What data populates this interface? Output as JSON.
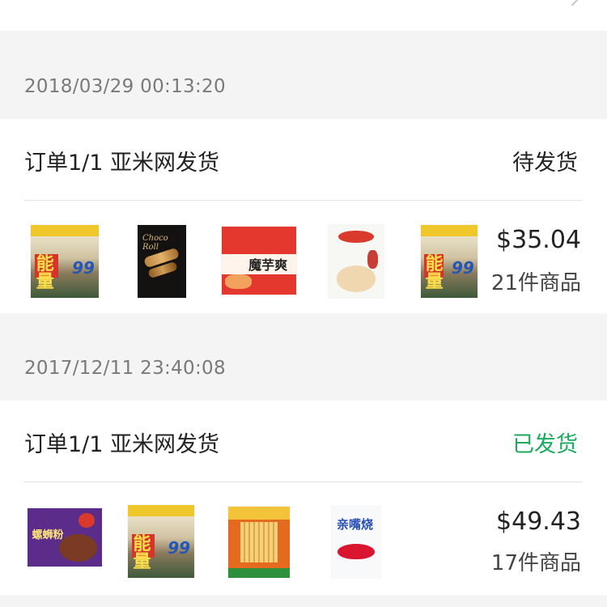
{
  "orders": [
    {
      "datetime": "2018/03/29 00:13:20",
      "title": "订单1/1 亚米网发货",
      "status": "待发货",
      "price": "$35.04",
      "count": "21件商品",
      "products": [
        "energy-99-bag",
        "choco-roll-box",
        "mochi-snack-bag",
        "shrimp-flakes-bag",
        "energy-99-bag"
      ]
    },
    {
      "datetime": "2017/12/11 23:40:08",
      "title": "订单1/1 亚米网发货",
      "status": "已发货",
      "price": "$49.43",
      "count": "17件商品",
      "products": [
        "noodle-pack",
        "energy-99-bag",
        "wangwang-senbei-bag",
        "lip-snack-bag"
      ]
    }
  ],
  "colors": {
    "shipped": "#1aab5c",
    "pending": "#222222",
    "background": "#f4f4f4"
  }
}
